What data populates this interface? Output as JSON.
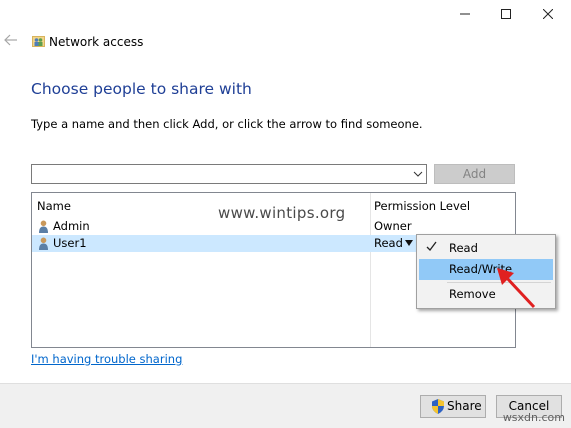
{
  "window": {
    "title": "Network access"
  },
  "page": {
    "heading": "Choose people to share with",
    "instructions": "Type a name and then click Add, or click the arrow to find someone."
  },
  "name_input": {
    "value": "",
    "add_label": "Add"
  },
  "table": {
    "columns": [
      "Name",
      "Permission Level"
    ],
    "rows": [
      {
        "name": "Admin",
        "permission": "Owner"
      },
      {
        "name": "User1",
        "permission": "Read"
      }
    ]
  },
  "context_menu": {
    "items": [
      {
        "label": "Read",
        "checked": true
      },
      {
        "label": "Read/Write",
        "highlighted": true
      },
      {
        "label": "Remove"
      }
    ]
  },
  "watermark": "www.wintips.org",
  "trouble_link": "I'm having trouble sharing",
  "footer": {
    "share_label": "Share",
    "cancel_label": "Cancel",
    "site_mark": "wsxdn.com"
  },
  "colors": {
    "heading": "#1f3f96",
    "link": "#0066cc",
    "selection": "#cce8ff",
    "menu_highlight": "#91c9f7",
    "arrow": "#e02020"
  },
  "icons": [
    "minimize-icon",
    "maximize-icon",
    "close-icon",
    "back-arrow-icon",
    "network-icon",
    "user-icon",
    "check-icon",
    "shield-icon",
    "dropdown-arrow-icon"
  ]
}
